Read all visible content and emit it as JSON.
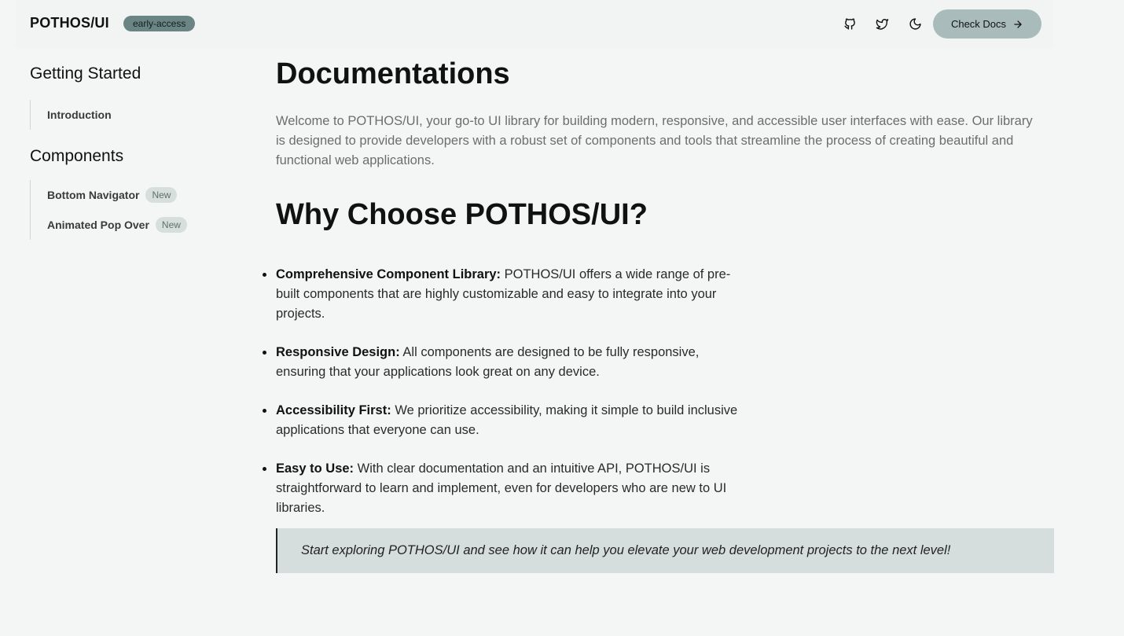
{
  "header": {
    "logo": "POTHOS/UI",
    "badge": "early-access",
    "icons": [
      "github-icon",
      "twitter-icon",
      "moon-icon"
    ],
    "docs_button": "Check Docs"
  },
  "sidebar": {
    "sections": [
      {
        "title": "Getting Started",
        "items": [
          {
            "label": "Introduction",
            "badge": ""
          }
        ]
      },
      {
        "title": "Components",
        "items": [
          {
            "label": "Bottom Navigator",
            "badge": "New"
          },
          {
            "label": "Animated Pop Over",
            "badge": "New"
          }
        ]
      }
    ]
  },
  "main": {
    "title": "Documentations",
    "intro": "Welcome to POTHOS/UI, your go-to UI library for building modern, responsive, and accessible user interfaces with ease. Our library is designed to provide developers with a robust set of components and tools that streamline the process of creating beautiful and functional web applications.",
    "why_title": "Why Choose POTHOS/UI?",
    "features": [
      {
        "title": "Comprehensive Component Library:",
        "text": " POTHOS/UI offers a wide range of pre-built components that are highly customizable and easy to integrate into your projects."
      },
      {
        "title": "Responsive Design:",
        "text": " All components are designed to be fully responsive, ensuring that your applications look great on any device."
      },
      {
        "title": "Accessibility First:",
        "text": " We prioritize accessibility, making it simple to build inclusive applications that everyone can use."
      },
      {
        "title": "Easy to Use:",
        "text": " With clear documentation and an intuitive API, POTHOS/UI is straightforward to learn and implement, even for developers who are new to UI libraries."
      }
    ],
    "quote": "Start exploring POTHOS/UI and see how it can help you elevate your web development projects to the next level!"
  }
}
